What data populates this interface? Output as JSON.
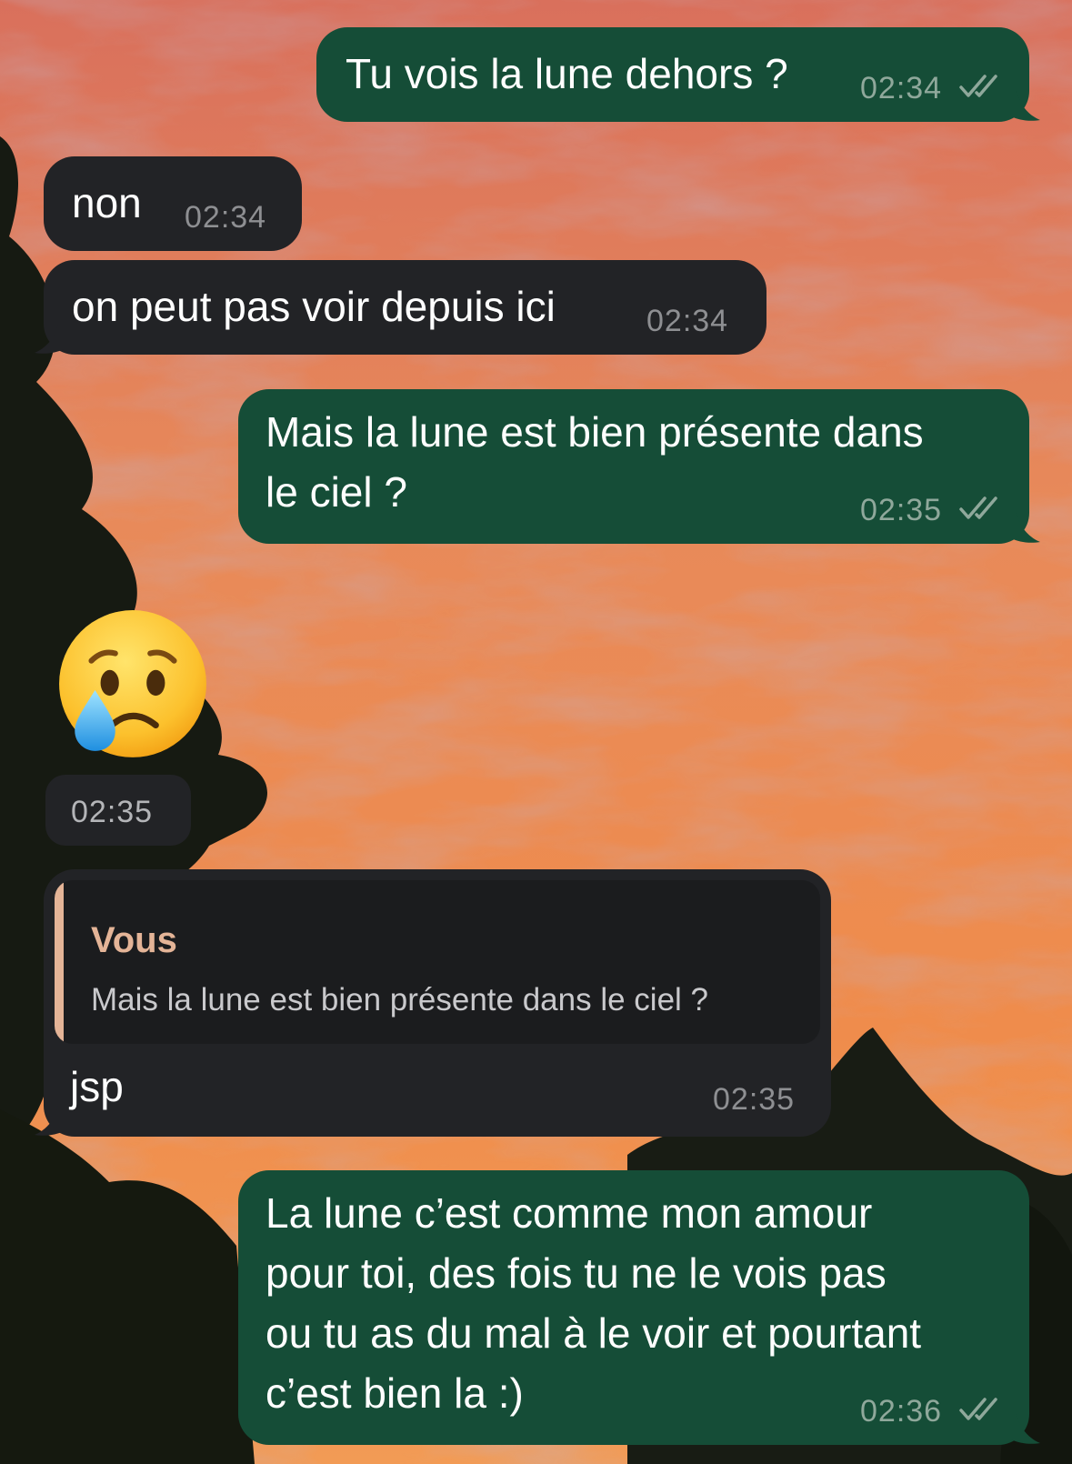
{
  "conversation": {
    "messages": [
      {
        "direction": "outgoing",
        "text": "Tu vois la lune dehors ?",
        "time": "02:34",
        "status": "read"
      },
      {
        "direction": "incoming",
        "text": "non",
        "time": "02:34"
      },
      {
        "direction": "incoming",
        "text": "on peut pas voir depuis ici",
        "time": "02:34"
      },
      {
        "direction": "outgoing",
        "text_lines": [
          "Mais la lune est bien présente dans",
          "le ciel ?"
        ],
        "time": "02:35",
        "status": "read"
      },
      {
        "direction": "incoming",
        "type": "emoji",
        "emoji": "crying-face-emoji",
        "time": "02:35"
      },
      {
        "direction": "incoming",
        "reply_to": {
          "author": "Vous",
          "text": "Mais la lune est bien présente dans le ciel ?"
        },
        "text": "jsp",
        "time": "02:35"
      },
      {
        "direction": "outgoing",
        "text_lines": [
          "La lune c’est comme mon amour",
          "pour toi, des fois tu ne le vois pas",
          "ou tu as du mal à le voir et pourtant",
          "c’est bien la :)"
        ],
        "time": "02:36",
        "status": "read"
      }
    ]
  },
  "colors": {
    "outgoing_bubble": "#154d37",
    "incoming_bubble": "#222326",
    "reply_accent": "#e4b497"
  }
}
